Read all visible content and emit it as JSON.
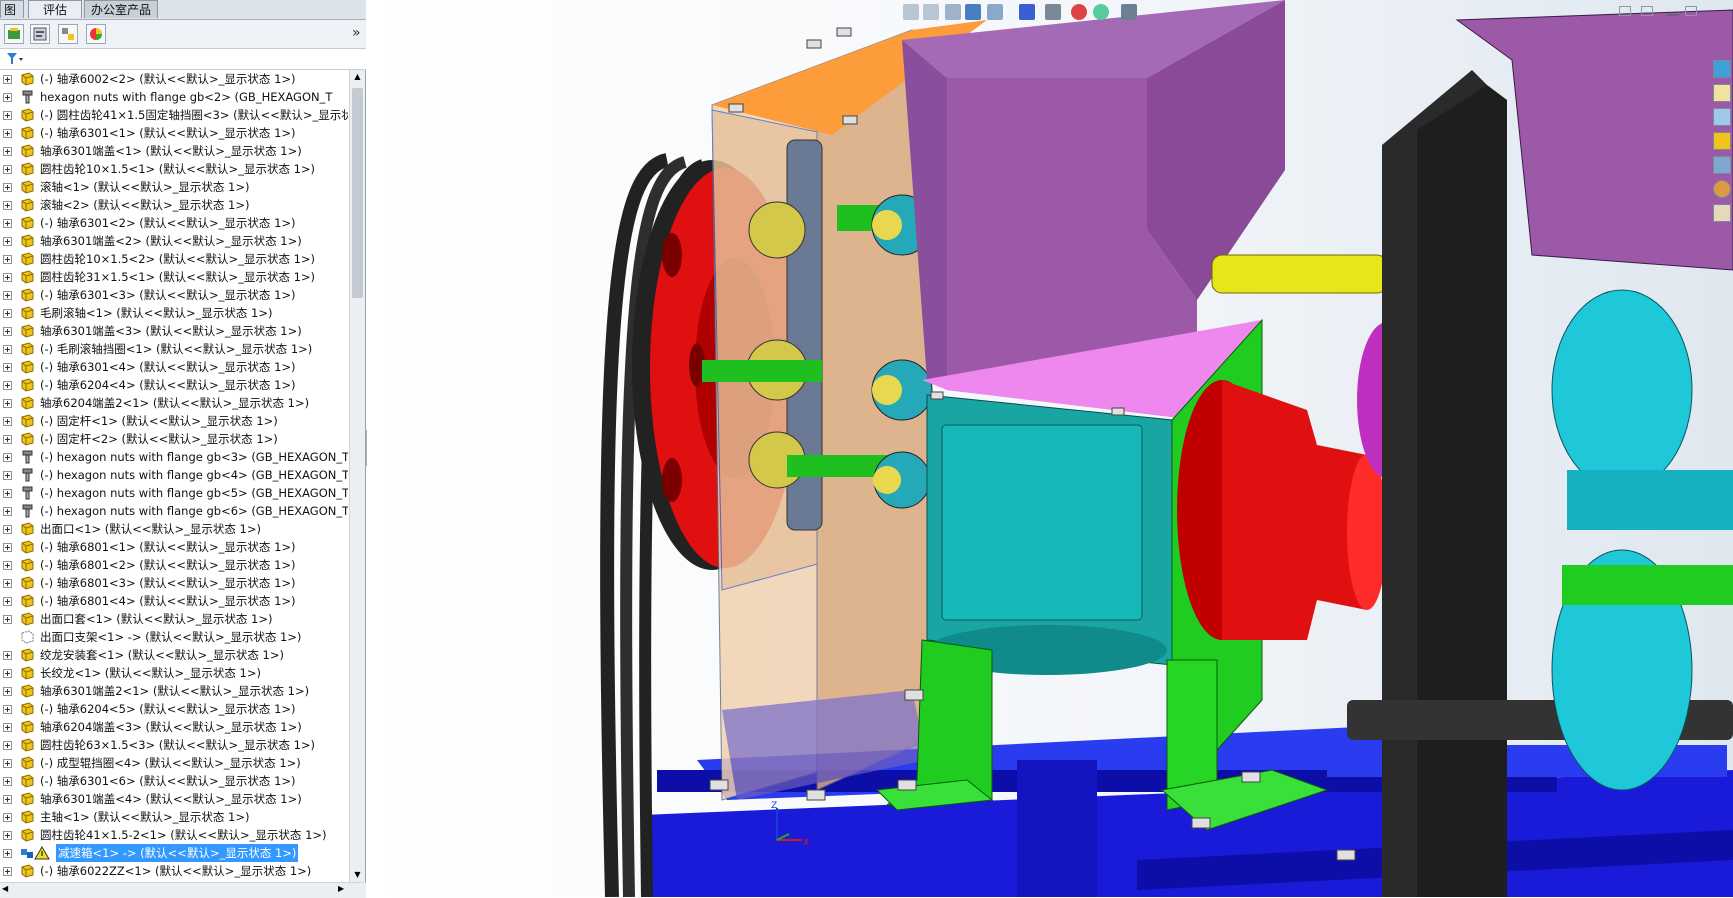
{
  "tabs": [
    {
      "label": "图"
    },
    {
      "label": "评估"
    },
    {
      "label": "办公室产品"
    }
  ],
  "panel": {
    "collapse_glyph": "»",
    "filter_icon": "filter-icon"
  },
  "tree_items": [
    {
      "label": "(-) 轴承6002<2> (默认<<默认>_显示状态 1>)",
      "icon": "part",
      "expand": true
    },
    {
      "label": "hexagon nuts with flange gb<2> (GB_HEXAGON_T",
      "icon": "fastener",
      "expand": true
    },
    {
      "label": "(-) 圆柱齿轮41×1.5固定轴挡圈<3> (默认<<默认>_显示状",
      "icon": "part",
      "expand": true
    },
    {
      "label": "(-) 轴承6301<1> (默认<<默认>_显示状态 1>)",
      "icon": "part",
      "expand": true
    },
    {
      "label": "轴承6301端盖<1> (默认<<默认>_显示状态 1>)",
      "icon": "part",
      "expand": true
    },
    {
      "label": "圆柱齿轮10×1.5<1> (默认<<默认>_显示状态 1>)",
      "icon": "part",
      "expand": true
    },
    {
      "label": "滚轴<1> (默认<<默认>_显示状态 1>)",
      "icon": "part",
      "expand": true
    },
    {
      "label": "滚轴<2> (默认<<默认>_显示状态 1>)",
      "icon": "part",
      "expand": true
    },
    {
      "label": "(-) 轴承6301<2> (默认<<默认>_显示状态 1>)",
      "icon": "part",
      "expand": true
    },
    {
      "label": "轴承6301端盖<2> (默认<<默认>_显示状态 1>)",
      "icon": "part",
      "expand": true
    },
    {
      "label": "圆柱齿轮10×1.5<2> (默认<<默认>_显示状态 1>)",
      "icon": "part",
      "expand": true
    },
    {
      "label": "圆柱齿轮31×1.5<1> (默认<<默认>_显示状态 1>)",
      "icon": "part",
      "expand": true
    },
    {
      "label": "(-) 轴承6301<3> (默认<<默认>_显示状态 1>)",
      "icon": "part",
      "expand": true
    },
    {
      "label": "毛刷滚轴<1> (默认<<默认>_显示状态 1>)",
      "icon": "part",
      "expand": true
    },
    {
      "label": "轴承6301端盖<3> (默认<<默认>_显示状态 1>)",
      "icon": "part",
      "expand": true
    },
    {
      "label": "(-) 毛刷滚轴挡圈<1> (默认<<默认>_显示状态 1>)",
      "icon": "part",
      "expand": true
    },
    {
      "label": "(-) 轴承6301<4> (默认<<默认>_显示状态 1>)",
      "icon": "part",
      "expand": true
    },
    {
      "label": "(-) 轴承6204<4> (默认<<默认>_显示状态 1>)",
      "icon": "part",
      "expand": true
    },
    {
      "label": "轴承6204端盖2<1> (默认<<默认>_显示状态 1>)",
      "icon": "part",
      "expand": true
    },
    {
      "label": "(-) 固定杆<1> (默认<<默认>_显示状态 1>)",
      "icon": "part",
      "expand": true
    },
    {
      "label": "(-) 固定杆<2> (默认<<默认>_显示状态 1>)",
      "icon": "part",
      "expand": true
    },
    {
      "label": "(-) hexagon nuts with flange gb<3> (GB_HEXAGON_T",
      "icon": "fastener",
      "expand": true
    },
    {
      "label": "(-) hexagon nuts with flange gb<4> (GB_HEXAGON_T",
      "icon": "fastener",
      "expand": true
    },
    {
      "label": "(-) hexagon nuts with flange gb<5> (GB_HEXAGON_T",
      "icon": "fastener",
      "expand": true
    },
    {
      "label": "(-) hexagon nuts with flange gb<6> (GB_HEXAGON_T",
      "icon": "fastener",
      "expand": true
    },
    {
      "label": "出面口<1> (默认<<默认>_显示状态 1>)",
      "icon": "part",
      "expand": true
    },
    {
      "label": "(-) 轴承6801<1> (默认<<默认>_显示状态 1>)",
      "icon": "part",
      "expand": true
    },
    {
      "label": "(-) 轴承6801<2> (默认<<默认>_显示状态 1>)",
      "icon": "part",
      "expand": true
    },
    {
      "label": "(-) 轴承6801<3> (默认<<默认>_显示状态 1>)",
      "icon": "part",
      "expand": true
    },
    {
      "label": "(-) 轴承6801<4> (默认<<默认>_显示状态 1>)",
      "icon": "part",
      "expand": true
    },
    {
      "label": "出面口套<1> (默认<<默认>_显示状态 1>)",
      "icon": "part",
      "expand": true
    },
    {
      "label": "出面口支架<1> -> (默认<<默认>_显示状态 1>)",
      "icon": "part-ref",
      "expand": false
    },
    {
      "label": "绞龙安装套<1> (默认<<默认>_显示状态 1>)",
      "icon": "part",
      "expand": true
    },
    {
      "label": "长绞龙<1> (默认<<默认>_显示状态 1>)",
      "icon": "part",
      "expand": true
    },
    {
      "label": "轴承6301端盖2<1> (默认<<默认>_显示状态 1>)",
      "icon": "part",
      "expand": true
    },
    {
      "label": "(-) 轴承6204<5> (默认<<默认>_显示状态 1>)",
      "icon": "part",
      "expand": true
    },
    {
      "label": "轴承6204端盖<3> (默认<<默认>_显示状态 1>)",
      "icon": "part",
      "expand": true
    },
    {
      "label": "圆柱齿轮63×1.5<3> (默认<<默认>_显示状态 1>)",
      "icon": "part",
      "expand": true
    },
    {
      "label": "(-) 成型辊挡圈<4> (默认<<默认>_显示状态 1>)",
      "icon": "part",
      "expand": true
    },
    {
      "label": "(-) 轴承6301<6> (默认<<默认>_显示状态 1>)",
      "icon": "part",
      "expand": true
    },
    {
      "label": "轴承6301端盖<4> (默认<<默认>_显示状态 1>)",
      "icon": "part",
      "expand": true
    },
    {
      "label": "主轴<1> (默认<<默认>_显示状态 1>)",
      "icon": "part",
      "expand": true
    },
    {
      "label": "圆柱齿轮41×1.5-2<1> (默认<<默认>_显示状态 1>)",
      "icon": "part",
      "expand": true
    },
    {
      "label": "减速箱<1> -> (默认<<默认>_显示状态 1>)",
      "icon": "assembly-warning",
      "expand": true,
      "selected": true
    },
    {
      "label": "(-) 轴承6022ZZ<1> (默认<<默认>_显示状态 1>)",
      "icon": "part",
      "expand": true
    }
  ],
  "triad": {
    "z": "Z",
    "x": "X"
  },
  "colors": {
    "selection": "#3399ff",
    "hopper": "#9b59a8",
    "frame_orange": "#ff8c1a",
    "gearbox_transparent": "#d9a87a",
    "housing_teal": "#1aa5a5",
    "bracket_green": "#1fcc1f",
    "base_blue": "#1a1ad9",
    "pulley_red": "#e01010",
    "shaft_yellow": "#e6e61a",
    "roller_cyan": "#1ec8d8",
    "side_frame": "#2a2a2a"
  }
}
